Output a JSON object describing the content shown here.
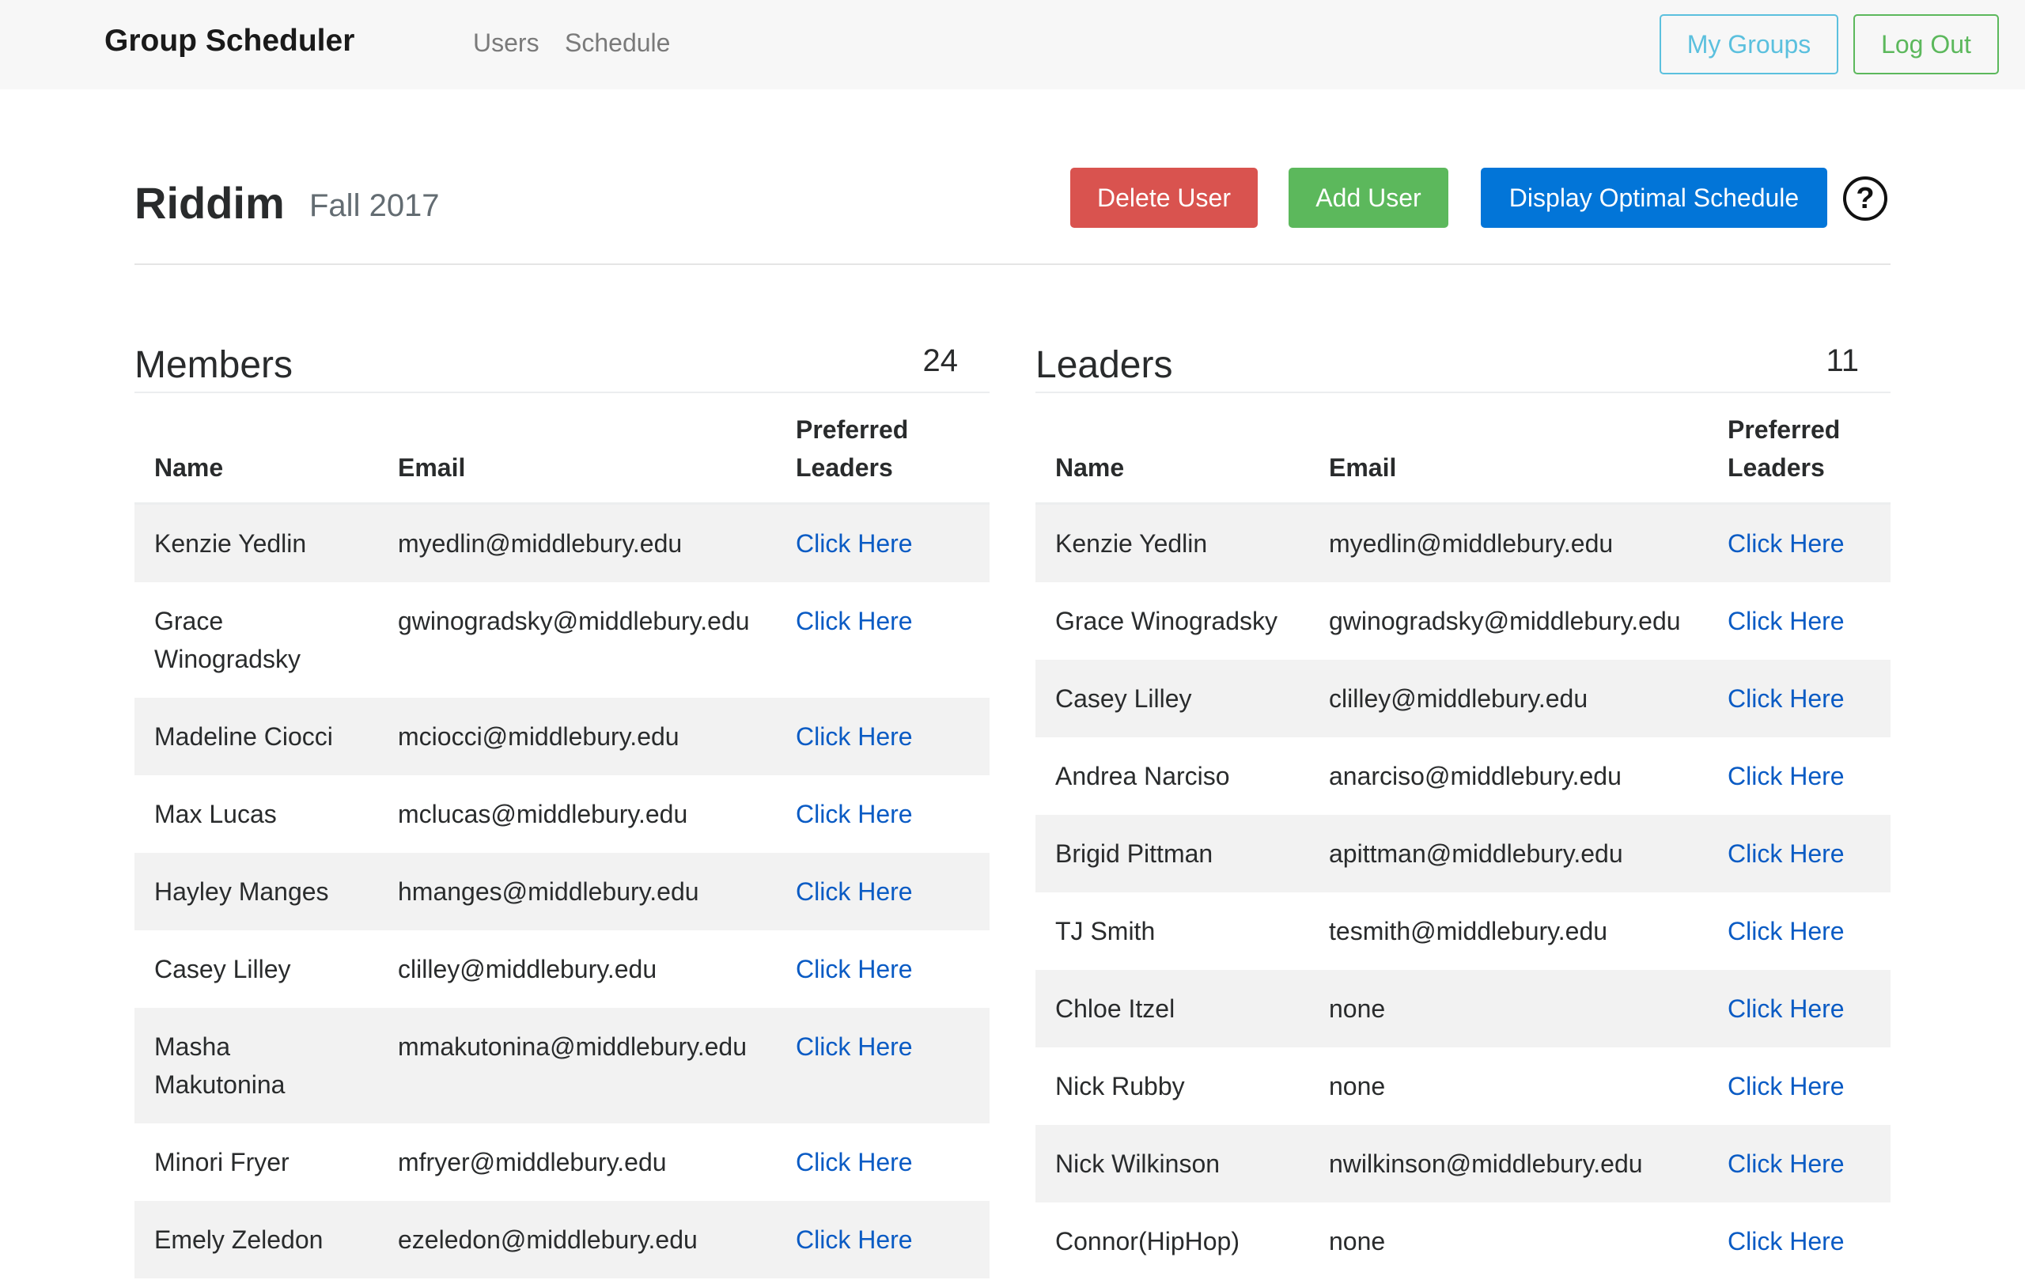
{
  "navbar": {
    "brand": "Group Scheduler",
    "links": [
      "Users",
      "Schedule"
    ],
    "my_groups_label": "My Groups",
    "logout_label": "Log Out"
  },
  "header": {
    "title": "Riddim",
    "term": "Fall 2017",
    "delete_label": "Delete User",
    "add_label": "Add User",
    "display_label": "Display Optimal Schedule",
    "help_glyph": "?"
  },
  "members": {
    "title": "Members",
    "count": "24",
    "columns": [
      "Name",
      "Email",
      "Preferred Leaders"
    ],
    "rows": [
      {
        "name": "Kenzie Yedlin",
        "email": "myedlin@middlebury.edu",
        "link": "Click Here"
      },
      {
        "name": "Grace Winogradsky",
        "email": "gwinogradsky@middlebury.edu",
        "link": "Click Here"
      },
      {
        "name": "Madeline Ciocci",
        "email": "mciocci@middlebury.edu",
        "link": "Click Here"
      },
      {
        "name": "Max Lucas",
        "email": "mclucas@middlebury.edu",
        "link": "Click Here"
      },
      {
        "name": "Hayley Manges",
        "email": "hmanges@middlebury.edu",
        "link": "Click Here"
      },
      {
        "name": "Casey Lilley",
        "email": "clilley@middlebury.edu",
        "link": "Click Here"
      },
      {
        "name": "Masha Makutonina",
        "email": "mmakutonina@middlebury.edu",
        "link": "Click Here"
      },
      {
        "name": "Minori Fryer",
        "email": "mfryer@middlebury.edu",
        "link": "Click Here"
      },
      {
        "name": "Emely Zeledon",
        "email": "ezeledon@middlebury.edu",
        "link": "Click Here"
      }
    ]
  },
  "leaders": {
    "title": "Leaders",
    "count": "11",
    "columns": [
      "Name",
      "Email",
      "Preferred Leaders"
    ],
    "rows": [
      {
        "name": "Kenzie Yedlin",
        "email": "myedlin@middlebury.edu",
        "link": "Click Here"
      },
      {
        "name": "Grace Winogradsky",
        "email": "gwinogradsky@middlebury.edu",
        "link": "Click Here"
      },
      {
        "name": "Casey Lilley",
        "email": "clilley@middlebury.edu",
        "link": "Click Here"
      },
      {
        "name": "Andrea Narciso",
        "email": "anarciso@middlebury.edu",
        "link": "Click Here"
      },
      {
        "name": "Brigid Pittman",
        "email": "apittman@middlebury.edu",
        "link": "Click Here"
      },
      {
        "name": "TJ Smith",
        "email": "tesmith@middlebury.edu",
        "link": "Click Here"
      },
      {
        "name": "Chloe Itzel",
        "email": "none",
        "link": "Click Here"
      },
      {
        "name": "Nick Rubby",
        "email": "none",
        "link": "Click Here"
      },
      {
        "name": "Nick Wilkinson",
        "email": "nwilkinson@middlebury.edu",
        "link": "Click Here"
      },
      {
        "name": "Connor(HipHop)",
        "email": "none",
        "link": "Click Here"
      }
    ]
  }
}
